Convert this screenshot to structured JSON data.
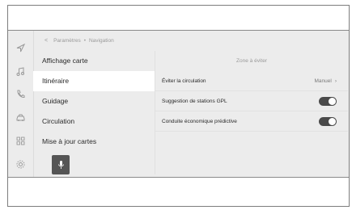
{
  "breadcrumb": {
    "back_label": "<",
    "parent": "Paramètres",
    "separator": "•",
    "current": "Navigation"
  },
  "rail": {
    "icons": [
      "navigation-arrow-icon",
      "music-note-icon",
      "phone-icon",
      "car-icon",
      "apps-grid-icon",
      "settings-gear-icon"
    ]
  },
  "menu": {
    "items": [
      {
        "label": "Affichage carte",
        "active": false
      },
      {
        "label": "Itinéraire",
        "active": true
      },
      {
        "label": "Guidage",
        "active": false
      },
      {
        "label": "Circulation",
        "active": false
      },
      {
        "label": "Mise à jour cartes",
        "active": false
      }
    ]
  },
  "mic": {
    "icon": "microphone-icon"
  },
  "panel": {
    "title": "Zone à éviter",
    "rows": [
      {
        "label": "Éviter la circulation",
        "value": "Manuel",
        "chevron": "›"
      },
      {
        "label": "Suggestion de stations GPL",
        "toggle": true
      },
      {
        "label": "Conduite économique prédictive",
        "toggle": true
      }
    ]
  },
  "colors": {
    "screen_bg": "#ececec",
    "active_item_bg": "#ffffff",
    "toggle_on": "#4a4a4a",
    "mic_button": "#555555"
  }
}
